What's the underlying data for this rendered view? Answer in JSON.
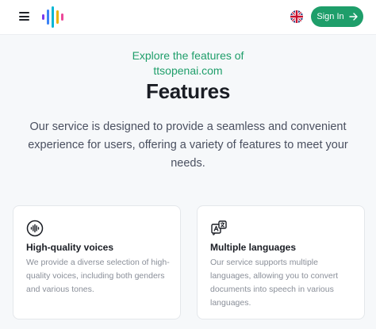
{
  "header": {
    "menu_icon": "hamburger-menu-icon",
    "logo_icon": "audio-bars-logo-icon",
    "language_icon": "uk-flag-icon",
    "signin_label": "Sign In",
    "signin_icon": "arrow-right-icon"
  },
  "hero": {
    "kicker_line1": "Explore the features of",
    "kicker_line2": "ttsopenai.com",
    "title": "Features",
    "description": "Our service is designed to provide a seamless and convenient experience for users, offering a variety of features to meet your needs."
  },
  "features": [
    {
      "icon": "voice-waveform-icon",
      "title": "High-quality voices",
      "text": "We provide a diverse selection of high-quality voices, including both genders and various tones."
    },
    {
      "icon": "translate-icon",
      "title": "Multiple languages",
      "text": "Our service supports multiple languages, allowing you to convert documents into speech in various languages."
    }
  ],
  "colors": {
    "accent": "#1e9e6a",
    "background": "#f6f8fa"
  }
}
